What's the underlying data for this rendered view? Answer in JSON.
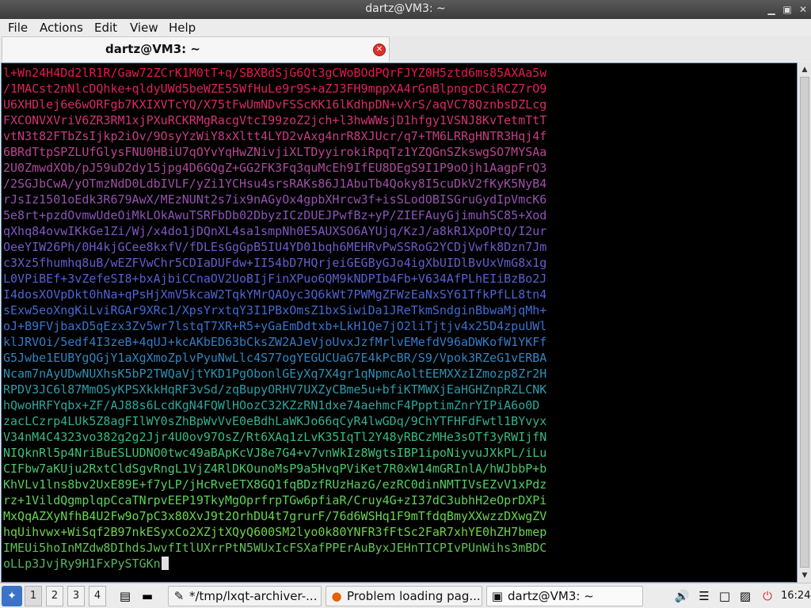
{
  "window": {
    "title": "dartz@VM3: ~"
  },
  "menubar": {
    "items": [
      "File",
      "Actions",
      "Edit",
      "View",
      "Help"
    ]
  },
  "tab": {
    "title": "dartz@VM3: ~",
    "close_icon": "close-icon"
  },
  "terminal": {
    "lines": [
      "l+Wn24H4Dd2lR1R/Gaw72ZCrK1M0tT+q/SBXBdSjG6Qt3gCWoBOdPQrFJYZ0H5ztd6ms85AXAa5w",
      "/1MACst2nNlcDQhke+qldyUWd5beWZE55WfHuLe9r9S+aZJ3FH9mppXA4rGnBlpngcDCiRCZ7rO9",
      "U6XHDlej6e6wORFgb7KXIXVTcYQ/X75tFwUmNDvFSScKK16lKdhpDN+vXrS/aqVC78QznbsDZLcg",
      "FXCONVXVriV6ZR3RM1xjPXuRCKRMgRacgVtcI99zoZ2jch+l3hwWWsjD1hfgy1VSNJ8KvTetmTtT",
      "vtN3t82FTbZsIjkp2iOv/9OsyYzWiY8xXltt4LYD2vAxg4nrR8XJUcr/q7+TM6LRRgHNTR3Hqj4f",
      "6BRdTtpSPZLUfGlysFNU0HBiU7qOYvYqHwZNivjiXLTDyyirokiRpqTz1YZQGnSZkswgSO7MYSAa",
      "2U0ZmwdXOb/pJ59uD2dy15jpg4D6GQgZ+GG2FK3Fq3quMcEh9IfEU8DEgS9I1P9oOjh1AagpFrQ3",
      "/2SGJbCwA/yOTmzNdD0LdbIVLF/yZi1YCHsu4srsRAKs86J1AbuTb4Qoky8I5cuDkV2fKyK5NyB4",
      "rJsIz1501oEdk3R679AwX/MEzNUNt2s7ix9nAGyOx4gpbXHrcw3f+isSLodOBISGruGydIpVmcK6",
      "5e8rt+pzdOvmwUdeOiMkLOkAwuTSRFbDb02DbyzICzDUEJPwfBz+yP/ZIEFAuyGjimuhSC85+Xod",
      "qXhq84ovwIKkGe1Zi/Wj/x4do1jDQnXL4sa1smpNh0E5AUXSO6AYUjq/KzJ/a8kR1XpOPtQ/I2ur",
      "OeeYIW26Ph/0H4kjGCee8kxfV/fDLEsGgGpB5IU4YD01bqh6MEHRvPwSSRoG2YCDjVwfk8Dzn7Jm",
      "c3Xz5fhumhq8uB/wEZFVwChr5CDIaDUFdw+II54bD7HQrjeiGEGByGJo4igXbUIDlBvUxVmG8x1g",
      "L0VPiBEf+3vZefeSI8+bxAjbiCCnaOV2UoBIjFinXPuo6QM9kNDPIb4Fb+V634AfPLhEIiBzBo2J",
      "I4dosXOVpDkt0hNa+qPsHjXmV5kcaW2TqkYMrQAOyc3Q6kWt7PWMgZFWzEaNxSY61TfkPfLL8tn4",
      "sExw5eoXngKiLviRGAr9XRc1/XpsYrxtqY3I1PBxOmsZ1bxSiwiDa1JReTkmSndginBbwaMjqMh+",
      "oJ+B9FVjbaxD5qEzx3Zv5wr7lstqT7XR+R5+yGaEmDdtxb+LkH1Qe7jO2liTjtjv4x25D4zpuUWl",
      "klJRVOi/5edf4I3zeB+4qUJ+kcAKbED63bCksZW2AJeVjoUvxJzfMrlvEMefdV96aDWKofW1YKFf",
      "G5Jwbe1EUBYgQGjY1aXgXmoZplvPyuNwLlc4S77ogYEGUCUaG7E4kPcBR/S9/Vpok3RZeG1vERBA",
      "Ncam7nAyUDwNUXhsK5bP2TWQaVjtYKD1PgObonlGEyXq7X4gr1qNpmcAoltEEMXXzIZmozp8Zr2H",
      "RPDV3JC6l87MmOSyKPSXkkHqRF3vSd/zqBupyORHV7UXZyCBme5u+bfiKTMWXjEaHGHZnpRZLCNK",
      "hQwoHRFYqbx+ZF/AJ88s6LcdKgN4FQWlHOozC32KZzRN1dxe74aehmcF4PpptimZnrYIPiA6o0D",
      "zacLCzrp4LUk5Z8agFIlWY0sZhBpWvVvE0eBdhLaWKJo66qCyR4lwGDq/9ChYTFHFdFwtl1BYvyx",
      "V34nM4C4323vo382g2g2Jjr4U0ov97OsZ/Rt6XAq1zLvK35IqTl2Y48yRBCzMHe3sOTf3yRWIjfN",
      "NIQknRl5p4NriBuESLUDNO0twc49aBApKcVJ8e7G4+v7vnWkIz8WgtsIBP1ipoNiyvuJXkPL/iLu",
      "CIFbw7aKUju2RxtCldSgvRngL1VjZ4RlDKOunoMsP9a5HvqPViKet7R0xW14mGRInlA/hWJbbP+b",
      "KhVLv1lns8bv2UxE89E+f7yLP/jHcRveETX8GQ1fqBDzfRUzHazG/ezRC0dinNMTIVsEZvV1xPdz",
      "rz+1VildQgmplqpCcaTNrpvEEP19TkyMgOprfrpTGw6pfiaR/Cruy4G+zI37dC3ubhH2eOprDXPi",
      "MxQqAZXyNfhB4U2Fw9o7pC3x80XvJ9t2OrhDU4t7grurF/76d6WSHq1F9mTfdqBmyXXwzzDXwgZV",
      "hqUihvwx+WiSqf2B97nkESyxCo2XZjtXQyQ600SM2lyo0k80YNFR3fFtSc2FaR7xhYE0hZH7bmep",
      "IMEUi5hoInMZdw8DIhdsJwvfItlUXrrPtN5WUxIcFSXafPPErAuByxJEHnTICPIvPUnWihs3mBDC",
      "oLLp3JvjRy9H1FxPySTGKn"
    ],
    "colors": [
      "#e8174f",
      "#e0205c",
      "#d82a68",
      "#d03374",
      "#c73c81",
      "#bc448f",
      "#ad4a9b",
      "#a04fa6",
      "#9552b0",
      "#8a55b9",
      "#7e58c2",
      "#725ac9",
      "#665ccf",
      "#5a5fd3",
      "#4e63d5",
      "#436ad3",
      "#3a72cf",
      "#347bc8",
      "#3086bf",
      "#2e91b4",
      "#2d9ca8",
      "#2ea69c",
      "#32b090",
      "#38b984",
      "#40c178",
      "#4ac86d",
      "#54ce62",
      "#5ed357",
      "#68d74e",
      "#6fd24a",
      "#62c455",
      "#56b660"
    ]
  },
  "taskbar": {
    "desktops": [
      "1",
      "2",
      "3",
      "4"
    ],
    "tasks": [
      {
        "icon": "text-editor-icon",
        "label": "*/tmp/lxqt-archiver-..."
      },
      {
        "icon": "firefox-icon",
        "label": "Problem loading pag..."
      },
      {
        "icon": "terminal-icon",
        "label": "dartz@VM3: ~"
      }
    ],
    "clock": "16:24"
  }
}
